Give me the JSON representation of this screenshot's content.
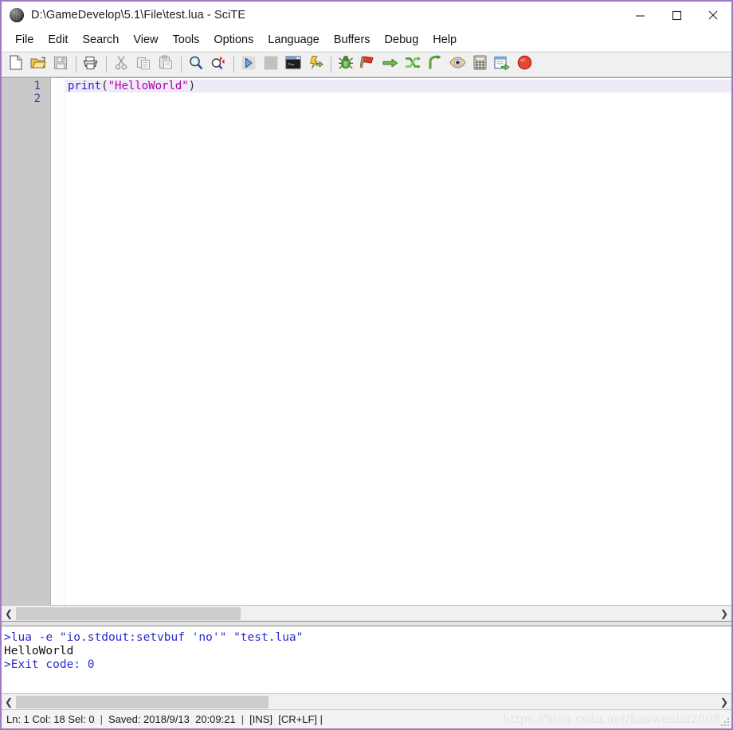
{
  "window": {
    "title": "D:\\GameDevelop\\5.1\\File\\test.lua - SciTE",
    "app_icon": "scite-ball-icon",
    "border_color": "#9c7cc0",
    "controls": {
      "minimize": "minimize-icon",
      "maximize": "maximize-icon",
      "close": "close-icon"
    }
  },
  "menubar": {
    "items": [
      {
        "label": "File"
      },
      {
        "label": "Edit"
      },
      {
        "label": "Search"
      },
      {
        "label": "View"
      },
      {
        "label": "Tools"
      },
      {
        "label": "Options"
      },
      {
        "label": "Language"
      },
      {
        "label": "Buffers"
      },
      {
        "label": "Debug"
      },
      {
        "label": "Help"
      }
    ]
  },
  "toolbar": {
    "groups": [
      {
        "buttons": [
          {
            "name": "new-file-icon",
            "tip": "New"
          },
          {
            "name": "open-file-icon",
            "tip": "Open"
          },
          {
            "name": "save-file-icon",
            "tip": "Save",
            "disabled": true
          }
        ]
      },
      {
        "buttons": [
          {
            "name": "print-icon",
            "tip": "Print"
          }
        ]
      },
      {
        "buttons": [
          {
            "name": "cut-icon",
            "tip": "Cut",
            "disabled": true
          },
          {
            "name": "copy-icon",
            "tip": "Copy",
            "disabled": true
          },
          {
            "name": "paste-icon",
            "tip": "Paste",
            "disabled": true
          }
        ]
      },
      {
        "buttons": [
          {
            "name": "find-icon",
            "tip": "Find"
          },
          {
            "name": "replace-icon",
            "tip": "Replace"
          }
        ]
      },
      {
        "buttons": [
          {
            "name": "run-icon",
            "tip": "Go"
          },
          {
            "name": "stop-icon",
            "tip": "Stop",
            "disabled": true
          },
          {
            "name": "console-icon",
            "tip": "Console"
          },
          {
            "name": "compile-icon",
            "tip": "Compile"
          }
        ]
      },
      {
        "buttons": [
          {
            "name": "debug-bug-icon",
            "tip": "Debug"
          },
          {
            "name": "breakpoint-flag-icon",
            "tip": "Breakpoint"
          },
          {
            "name": "step-over-icon",
            "tip": "Step Over"
          },
          {
            "name": "step-into-icon",
            "tip": "Step Into"
          },
          {
            "name": "step-out-icon",
            "tip": "Step Out"
          },
          {
            "name": "watch-eye-icon",
            "tip": "Watch"
          },
          {
            "name": "calculator-icon",
            "tip": "Evaluate"
          },
          {
            "name": "export-window-icon",
            "tip": "Output"
          },
          {
            "name": "terminate-icon",
            "tip": "Terminate"
          }
        ]
      }
    ]
  },
  "editor": {
    "line_numbers": [
      "1",
      "2"
    ],
    "current_line": 1,
    "lines": [
      {
        "tokens": [
          {
            "text": "print",
            "type": "fn"
          },
          {
            "text": "(",
            "type": "punct"
          },
          {
            "text": "\"HelloWorld\"",
            "type": "str"
          },
          {
            "text": ")",
            "type": "punct"
          }
        ]
      },
      {
        "tokens": []
      }
    ],
    "hscroll": {
      "left_arrow": "scroll-left-icon",
      "right_arrow": "scroll-right-icon",
      "thumb_width_pct": 32,
      "thumb_left_pct": 0
    }
  },
  "output": {
    "lines": [
      {
        "text": ">lua -e \"io.stdout:setvbuf 'no'\" \"test.lua\"",
        "style": "cmd"
      },
      {
        "text": "HelloWorld",
        "style": "text"
      },
      {
        "text": ">Exit code: 0",
        "style": "cmd"
      }
    ],
    "hscroll": {
      "left_arrow": "scroll-left-icon",
      "right_arrow": "scroll-right-icon",
      "thumb_width_pct": 36,
      "thumb_left_pct": 0
    }
  },
  "statusbar": {
    "position": "Ln: 1 Col: 18 Sel: 0",
    "saved": "Saved: 2018/9/13  20:09:21",
    "modes": "[INS]  [CR+LF] |",
    "separator": "|",
    "watermark": "https://blog.csdn.net/haowenlai2008"
  },
  "colors": {
    "frame": "#9c7cc0",
    "gutter": "#c9c9c9",
    "line_number": "#3b3b8f",
    "current_line_bg": "#eeeaf6",
    "keyword": "#2323c8",
    "string": "#b000b0",
    "output_cmd": "#2a2ad0"
  }
}
